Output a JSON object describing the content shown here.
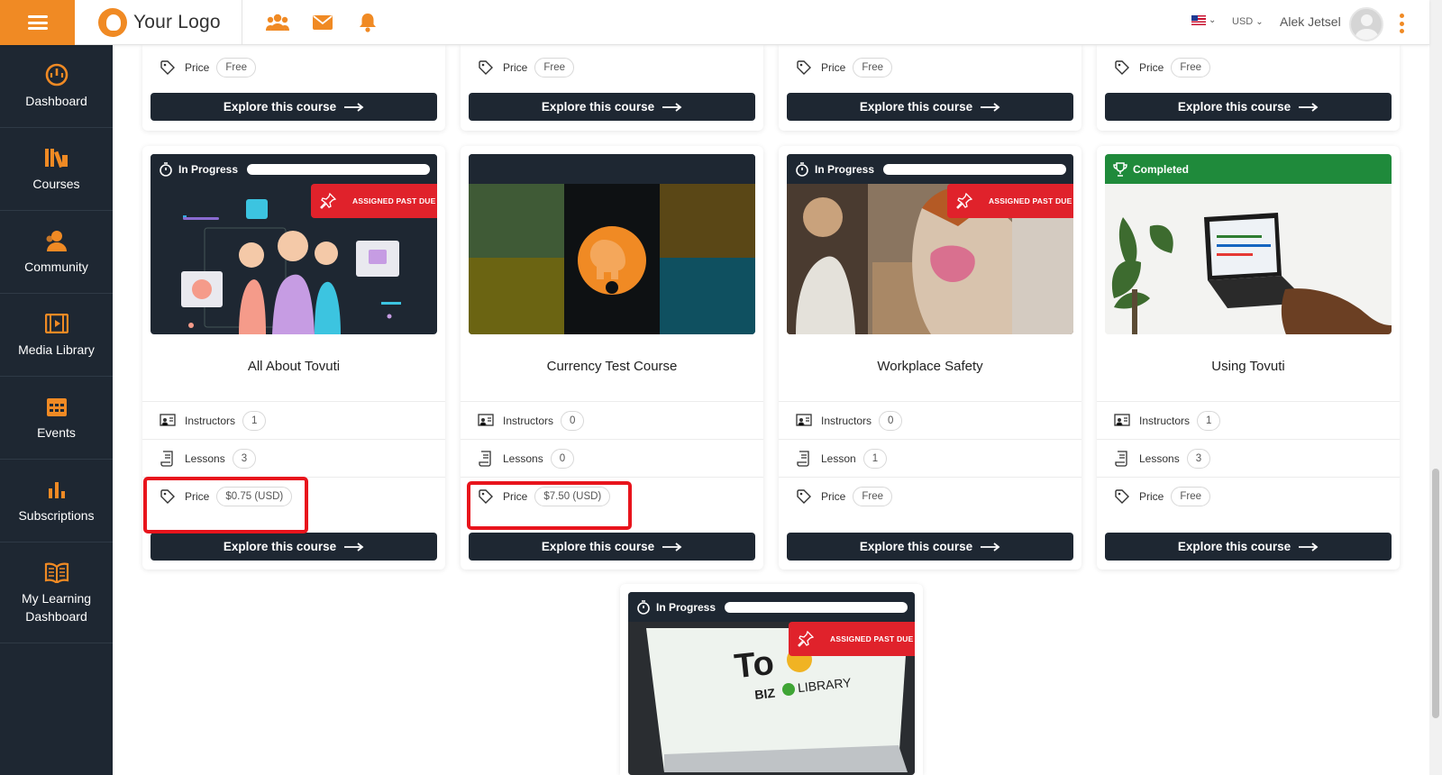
{
  "topbar": {
    "logo_text": "Your Logo",
    "currency": "USD",
    "user_name": "Alek Jetsel",
    "accent_color": "#f08a24"
  },
  "sidebar": {
    "items": [
      {
        "label": "Dashboard",
        "icon": "dashboard-gauge-icon"
      },
      {
        "label": "Courses",
        "icon": "library-books-icon"
      },
      {
        "label": "Community",
        "icon": "community-people-icon"
      },
      {
        "label": "Media Library",
        "icon": "film-strip-icon"
      },
      {
        "label": "Events",
        "icon": "calendar-icon"
      },
      {
        "label": "Subscriptions",
        "icon": "bar-chart-icon"
      },
      {
        "label": "My Learning Dashboard",
        "icon": "open-book-icon"
      }
    ]
  },
  "labels": {
    "price": "Price",
    "instructors": "Instructors",
    "lessons": "Lessons",
    "lesson": "Lesson",
    "explore": "Explore this course",
    "in_progress": "In Progress",
    "completed": "Completed",
    "assigned_past_due": "ASSIGNED PAST DUE"
  },
  "top_row_cards": [
    {
      "price": "Free"
    },
    {
      "price": "Free"
    },
    {
      "price": "Free"
    },
    {
      "price": "Free"
    }
  ],
  "courses": [
    {
      "title": "All About Tovuti",
      "status": "In Progress",
      "past_due": true,
      "instructors": "1",
      "lessons_label": "Lessons",
      "lessons": "3",
      "price": "$0.75 (USD)",
      "highlighted": true
    },
    {
      "title": "Currency Test Course",
      "status": "",
      "past_due": false,
      "instructors": "0",
      "lessons_label": "Lessons",
      "lessons": "0",
      "price": "$7.50 (USD)",
      "highlighted": true
    },
    {
      "title": "Workplace Safety",
      "status": "In Progress",
      "past_due": true,
      "instructors": "0",
      "lessons_label": "Lesson",
      "lessons": "1",
      "price": "Free",
      "highlighted": false
    },
    {
      "title": "Using Tovuti",
      "status": "Completed",
      "past_due": false,
      "instructors": "1",
      "lessons_label": "Lessons",
      "lessons": "3",
      "price": "Free",
      "highlighted": false
    }
  ],
  "bottom_card": {
    "status": "In Progress",
    "past_due": true,
    "image_text": "Tovuti BIZ LIBRARY"
  },
  "colors": {
    "sidebar_bg": "#1e2732",
    "past_due_red": "#e0222b",
    "completed_green": "#1f8a3b"
  }
}
